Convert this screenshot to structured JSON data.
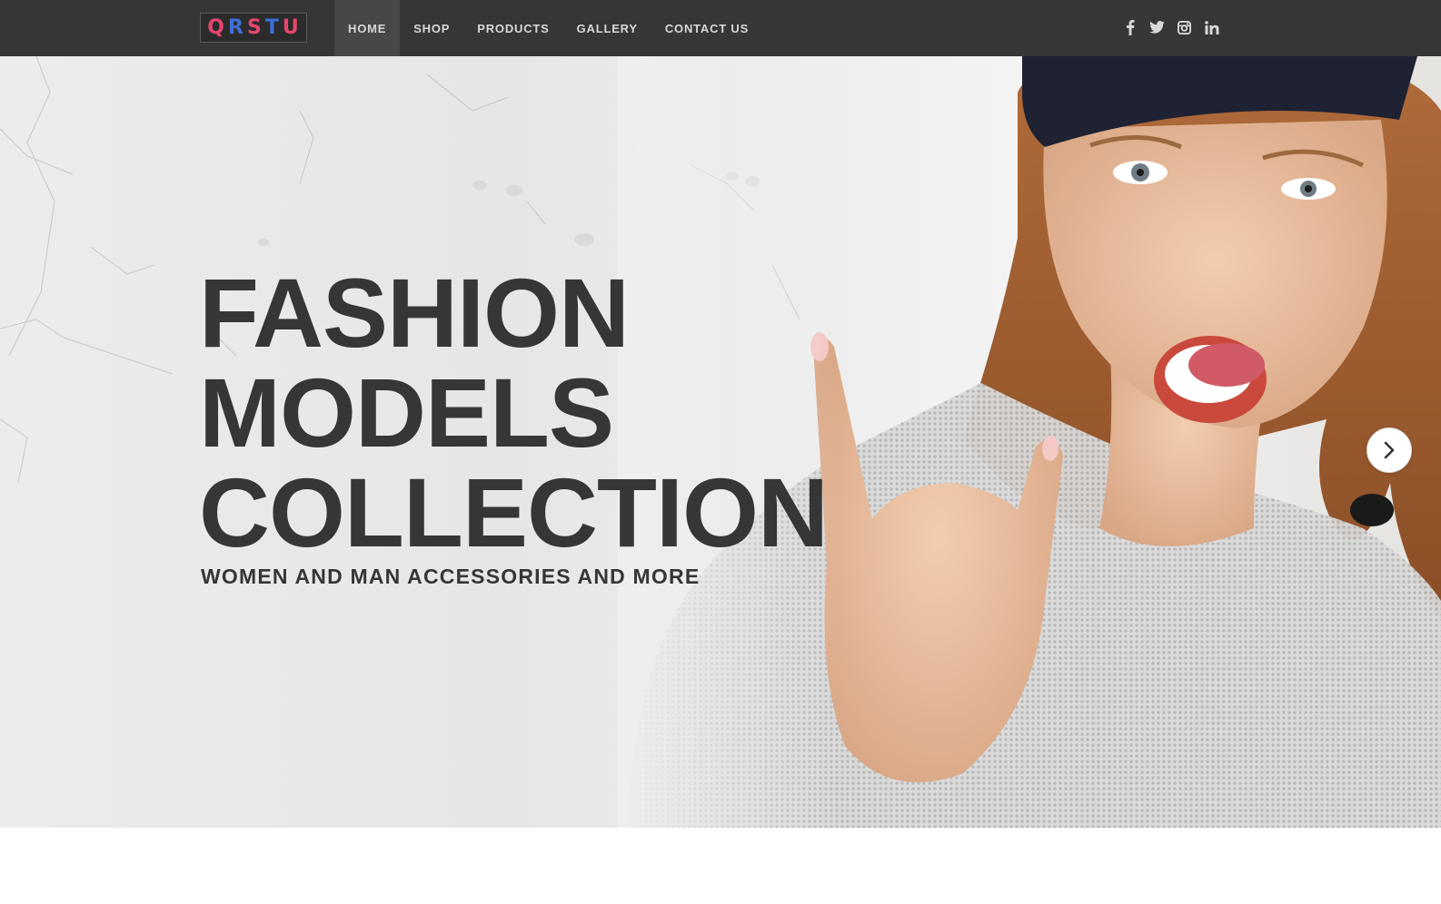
{
  "logo": {
    "letters": [
      "Q",
      "R",
      "S",
      "T",
      "U"
    ],
    "colors": [
      "#e8456f",
      "#3d6fd6",
      "#e8456f",
      "#3d6fd6",
      "#e8456f"
    ]
  },
  "nav": {
    "items": [
      {
        "label": "HOME"
      },
      {
        "label": "SHOP"
      },
      {
        "label": "PRODUCTS"
      },
      {
        "label": "GALLERY"
      },
      {
        "label": "CONTACT US"
      }
    ],
    "active": "HOME"
  },
  "social": [
    "facebook-icon",
    "twitter-icon",
    "instagram-icon",
    "linkedin-icon"
  ],
  "hero": {
    "headline": [
      "FASHION",
      "MODELS",
      "COLLECTION"
    ],
    "subheadline": "WOMEN AND MAN ACCESSORIES AND MORE",
    "next_icon": "chevron-right-icon"
  },
  "colors": {
    "topbar": "#363636",
    "nav_active": "#474747",
    "nav_text": "#d8d8d8",
    "headline": "#363636",
    "logo_pink": "#e8456f",
    "logo_blue": "#3d6fd6"
  }
}
